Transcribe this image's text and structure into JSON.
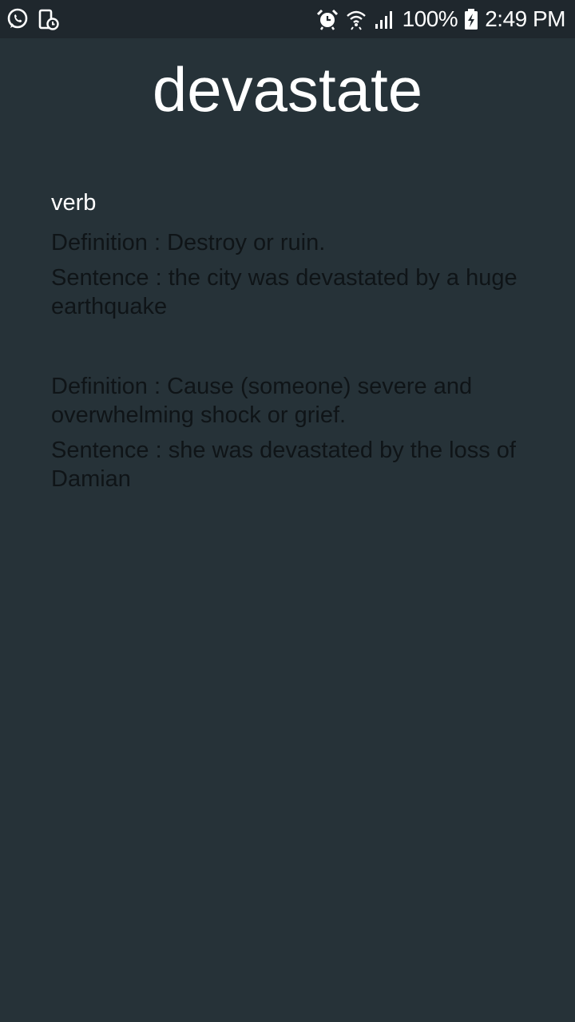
{
  "status_bar": {
    "battery": "100%",
    "time": "2:49 PM",
    "icons": [
      "whatsapp-icon",
      "screen-record-icon",
      "alarm-icon",
      "wifi-icon",
      "signal-icon",
      "battery-charging-icon"
    ]
  },
  "word": "devastate",
  "part_of_speech": "verb",
  "meanings": [
    {
      "definition": "Definition : Destroy or ruin.",
      "sentence": "Sentence : the city was devastated by a huge earthquake"
    },
    {
      "definition": "Definition : Cause (someone) severe and overwhelming shock or grief.",
      "sentence": "Sentence : she was devastated by the loss of Damian"
    }
  ],
  "colors": {
    "background": "#263238",
    "status_bar": "#1f272d",
    "title_text": "#ffffff",
    "body_text": "#0f1417"
  }
}
